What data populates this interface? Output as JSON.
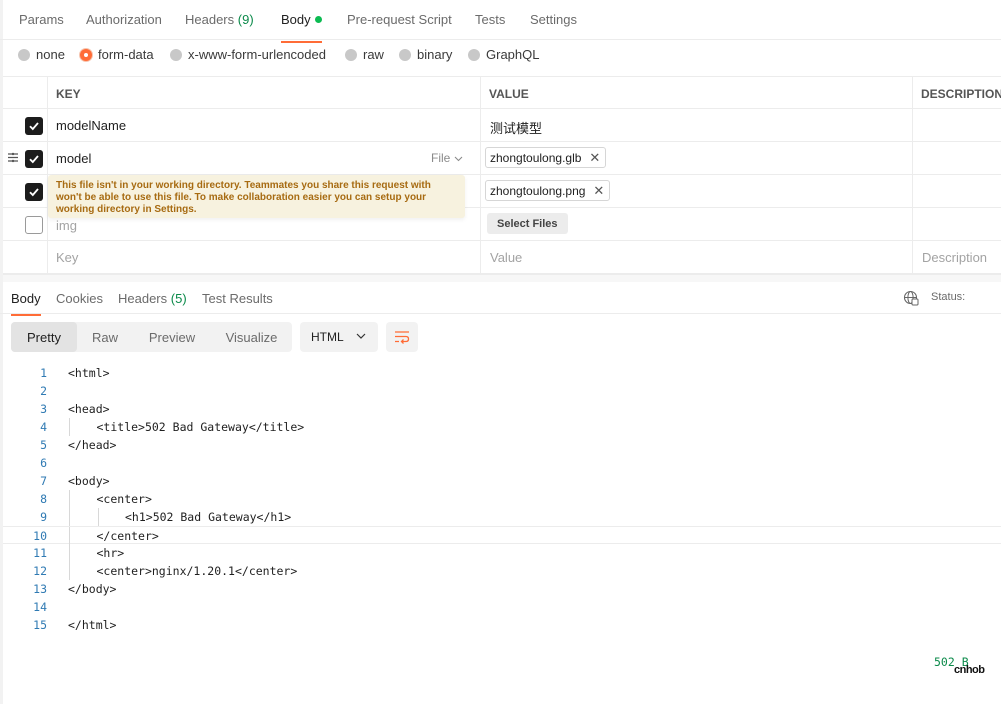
{
  "request_tabs": [
    {
      "label": "Params"
    },
    {
      "label": "Authorization"
    },
    {
      "label": "Headers",
      "count": "(9)"
    },
    {
      "label": "Body",
      "active": true
    },
    {
      "label": "Pre-request Script"
    },
    {
      "label": "Tests"
    },
    {
      "label": "Settings"
    }
  ],
  "body_types": [
    "none",
    "form-data",
    "x-www-form-urlencoded",
    "raw",
    "binary",
    "GraphQL"
  ],
  "selected_body_type": "form-data",
  "table": {
    "headers": {
      "key": "KEY",
      "value": "VALUE",
      "description": "DESCRIPTION"
    },
    "rows": [
      {
        "checked": true,
        "key": "modelName",
        "value": "测试模型"
      },
      {
        "checked": true,
        "key": "model",
        "type_select": "File",
        "file": "zhongtoulong.glb"
      },
      {
        "checked": true,
        "key": "",
        "file": "zhongtoulong.png"
      },
      {
        "checked": false,
        "key": "img",
        "button": "Select Files"
      }
    ],
    "placeholders": {
      "key": "Key",
      "value": "Value",
      "description": "Description"
    }
  },
  "tooltip": "This file isn't in your working directory. Teammates you share this request with won't be able to use this file. To make collaboration easier you can setup your working directory in Settings.",
  "response_tabs": [
    {
      "label": "Body",
      "active": true
    },
    {
      "label": "Cookies"
    },
    {
      "label": "Headers",
      "count": "(5)"
    },
    {
      "label": "Test Results"
    }
  ],
  "status": {
    "label": "Status:",
    "code": "502 B"
  },
  "view_modes": [
    "Pretty",
    "Raw",
    "Preview",
    "Visualize"
  ],
  "active_view": "Pretty",
  "language": "HTML",
  "code_lines": [
    {
      "n": "1",
      "indent": 0,
      "text": "<html>"
    },
    {
      "n": "2",
      "indent": 0,
      "text": ""
    },
    {
      "n": "3",
      "indent": 0,
      "text": "<head>"
    },
    {
      "n": "4",
      "indent": 1,
      "text": "<title>502 Bad Gateway</title>"
    },
    {
      "n": "5",
      "indent": 0,
      "text": "</head>"
    },
    {
      "n": "6",
      "indent": 0,
      "text": ""
    },
    {
      "n": "7",
      "indent": 0,
      "text": "<body>"
    },
    {
      "n": "8",
      "indent": 1,
      "text": "<center>"
    },
    {
      "n": "9",
      "indent": 2,
      "text": "<h1>502 Bad Gateway</h1>"
    },
    {
      "n": "10",
      "indent": 1,
      "text": "</center>"
    },
    {
      "n": "11",
      "indent": 1,
      "text": "<hr>"
    },
    {
      "n": "12",
      "indent": 1,
      "text": "<center>nginx/1.20.1</center>"
    },
    {
      "n": "13",
      "indent": 0,
      "text": "</body>"
    },
    {
      "n": "14",
      "indent": 0,
      "text": ""
    },
    {
      "n": "15",
      "indent": 0,
      "text": "</html>"
    }
  ],
  "current_line": "10",
  "brand": "cnhob",
  "colors": {
    "accent": "#ff6c37",
    "success": "#0cbb52",
    "count": "#0b8a4a",
    "warning_text": "#a76b12",
    "warning_bg": "#f7f2df"
  }
}
